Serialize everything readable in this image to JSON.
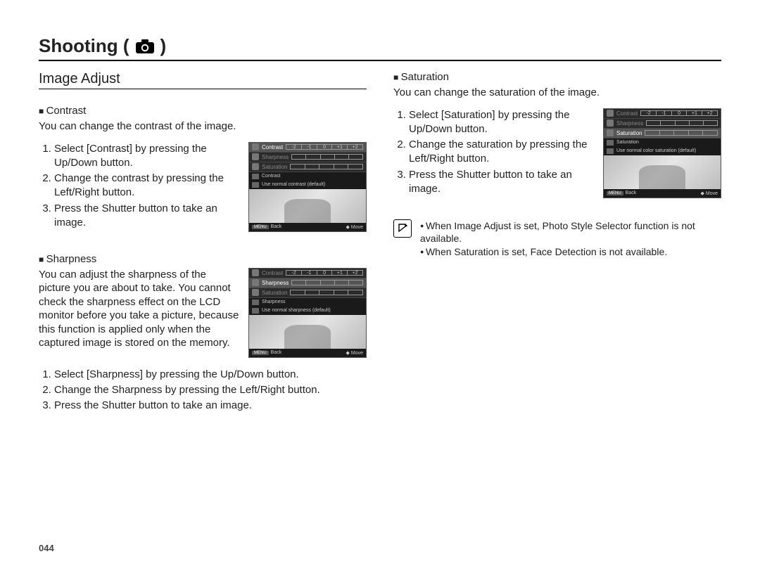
{
  "chapter_title": "Shooting (",
  "chapter_title_close": ")",
  "page_number": "044",
  "section_title": "Image Adjust",
  "topics": {
    "contrast": {
      "head": "Contrast",
      "desc": "You can change the contrast of the image.",
      "steps": [
        "Select [Contrast] by pressing the Up/Down button.",
        "Change the contrast by pressing the Left/Right button.",
        "Press the Shutter button to take an image."
      ]
    },
    "sharpness": {
      "head": "Sharpness",
      "desc": "You can adjust the sharpness of the picture you are about to take. You cannot check the sharpness effect on the LCD monitor before you take a picture, because this function is applied only when the captured image is stored on the memory.",
      "steps": [
        "Select [Sharpness] by pressing the Up/Down button.",
        "Change the Sharpness by pressing the Left/Right button.",
        "Press the Shutter button to take an image."
      ]
    },
    "saturation": {
      "head": "Saturation",
      "desc": "You can change the saturation of the image.",
      "steps": [
        "Select [Saturation] by pressing the Up/Down button.",
        "Change the saturation by pressing the Left/Right button.",
        "Press the Shutter button to take an image."
      ]
    }
  },
  "notes": [
    "When Image Adjust  is set, Photo Style Selector function is not available.",
    "When Saturation is set, Face Detection is not available."
  ],
  "lcd": {
    "ticks": [
      "-2",
      "-1",
      "0",
      "+1",
      "+2"
    ],
    "rows": [
      "Contrast",
      "Sharpness",
      "Saturation"
    ],
    "hint_contrast_title": "Contrast",
    "hint_contrast_text": "Use normal contrast (default)",
    "hint_sharpness_title": "Sharpness",
    "hint_sharpness_text": "Use normal sharpness (default)",
    "hint_saturation_title": "Saturation",
    "hint_saturation_text": "Use normal color saturation (default)",
    "back_btn": "MENU",
    "back_label": "Back",
    "move_label": "Move"
  }
}
